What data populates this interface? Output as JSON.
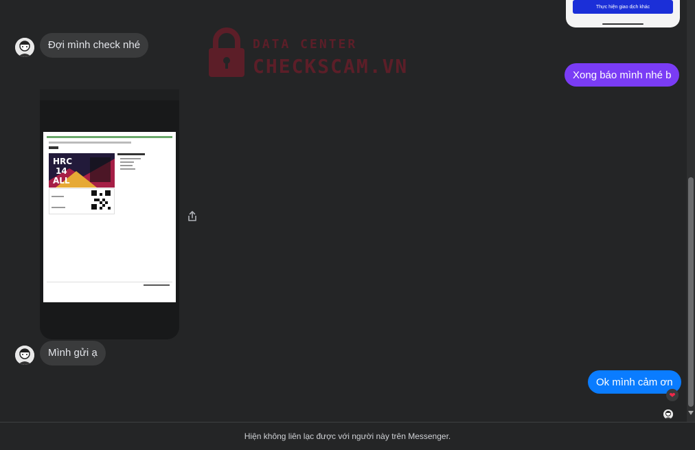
{
  "watermark": {
    "title": "DATA CENTER",
    "subtitle": "CHECKSCAM.VN"
  },
  "top_card": {
    "button_label": "Thực hiện giao dịch khác"
  },
  "messages": [
    {
      "sender": "contact",
      "text": "Đợi mình check nhé"
    },
    {
      "sender": "me",
      "text": "Xong báo mình nhé b"
    },
    {
      "sender": "contact",
      "text": "Mình gửi ạ"
    },
    {
      "sender": "me",
      "text": "Ok mình cảm ơn"
    }
  ],
  "reaction": {
    "icon": "heart-icon",
    "symbol": "❤"
  },
  "footer": {
    "notice": "Hiện không liên lạc được với người này trên Messenger."
  },
  "colors": {
    "background": "#242526",
    "incoming_bubble": "#3a3b3c",
    "outgoing_purple": "#7a3cf5",
    "outgoing_blue": "#0a7cff",
    "watermark": "#8b1a2b"
  }
}
